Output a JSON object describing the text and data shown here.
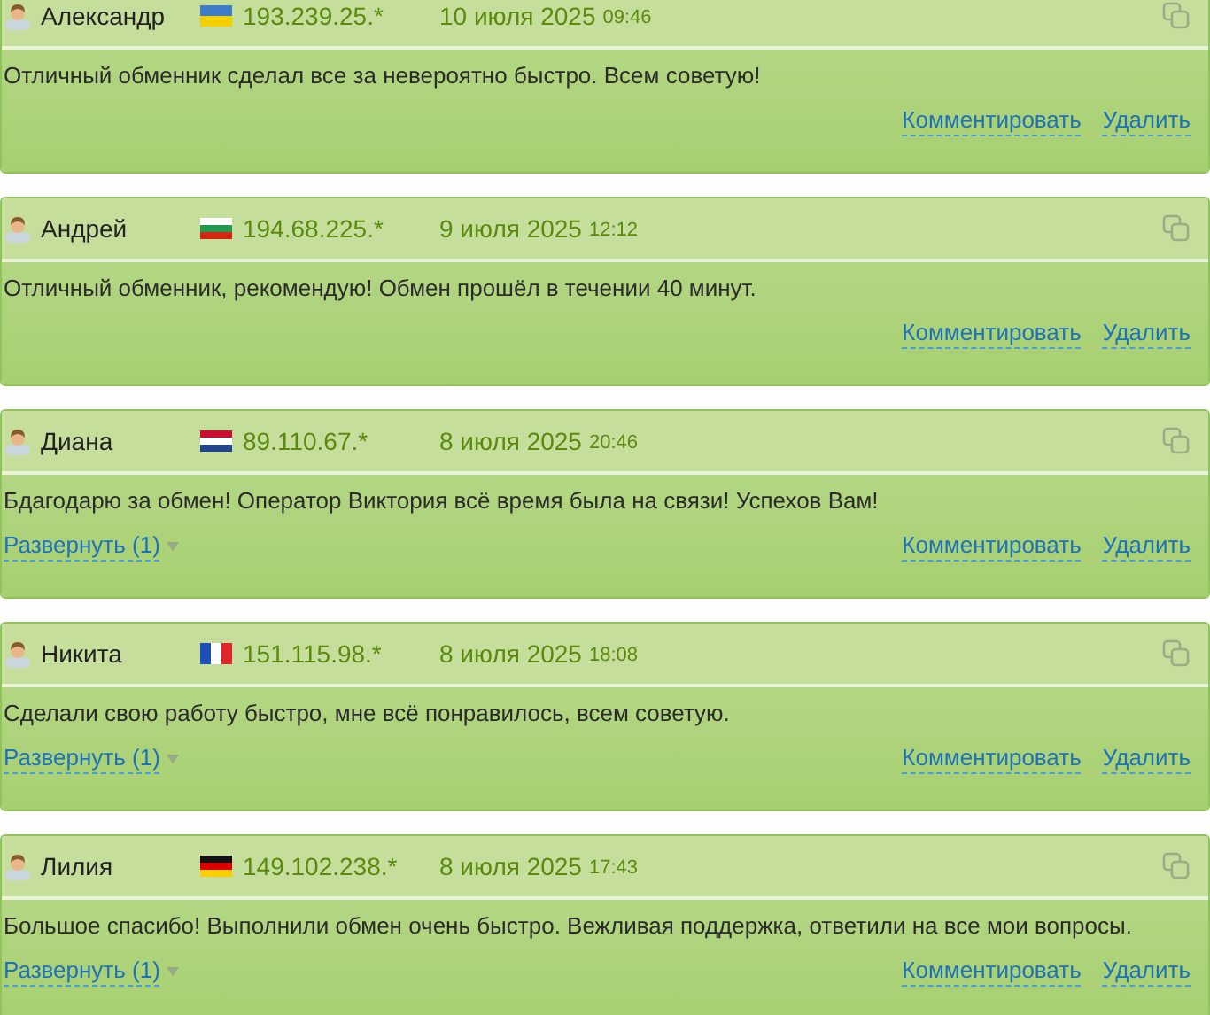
{
  "reviews": [
    {
      "name": "Александр",
      "kind": "ua",
      "ip": "193.239.25.*",
      "date": "10 июля 2025",
      "time": "09:46",
      "text": "Отличный обменник сделал все за невероятно быстро. Всем советую!",
      "comment": "Комментировать",
      "delete": "Удалить"
    },
    {
      "name": "Андрей",
      "kind": "bg",
      "ip": "194.68.225.*",
      "date": "9 июля 2025",
      "time": "12:12",
      "text": "Отличный обменник, рекомендую! Обмен прошёл в течении 40 минут.",
      "comment": "Комментировать",
      "delete": "Удалить"
    },
    {
      "name": "Диана",
      "kind": "nl",
      "ip": "89.110.67.*",
      "date": "8 июля 2025",
      "time": "20:46",
      "text": "Бдагодарю за обмен! Оператор Виктория всё время была на связи! Успехов Вам!",
      "expand": "Развернуть (1)",
      "comment": "Комментировать",
      "delete": "Удалить"
    },
    {
      "name": "Никита",
      "kind": "fr",
      "ip": "151.115.98.*",
      "date": "8 июля 2025",
      "time": "18:08",
      "text": "Сделали свою работу быстро, мне всё понравилось, всем советую.",
      "expand": "Развернуть (1)",
      "comment": "Комментировать",
      "delete": "Удалить"
    },
    {
      "name": "Лилия",
      "kind": "de",
      "ip": "149.102.238.*",
      "date": "8 июля 2025",
      "time": "17:43",
      "text": "Большое спасибо! Выполнили обмен очень быстро. Вежливая поддержка, ответили на все мои вопросы.",
      "expand": "Развернуть (1)",
      "comment": "Комментировать",
      "delete": "Удалить"
    }
  ]
}
